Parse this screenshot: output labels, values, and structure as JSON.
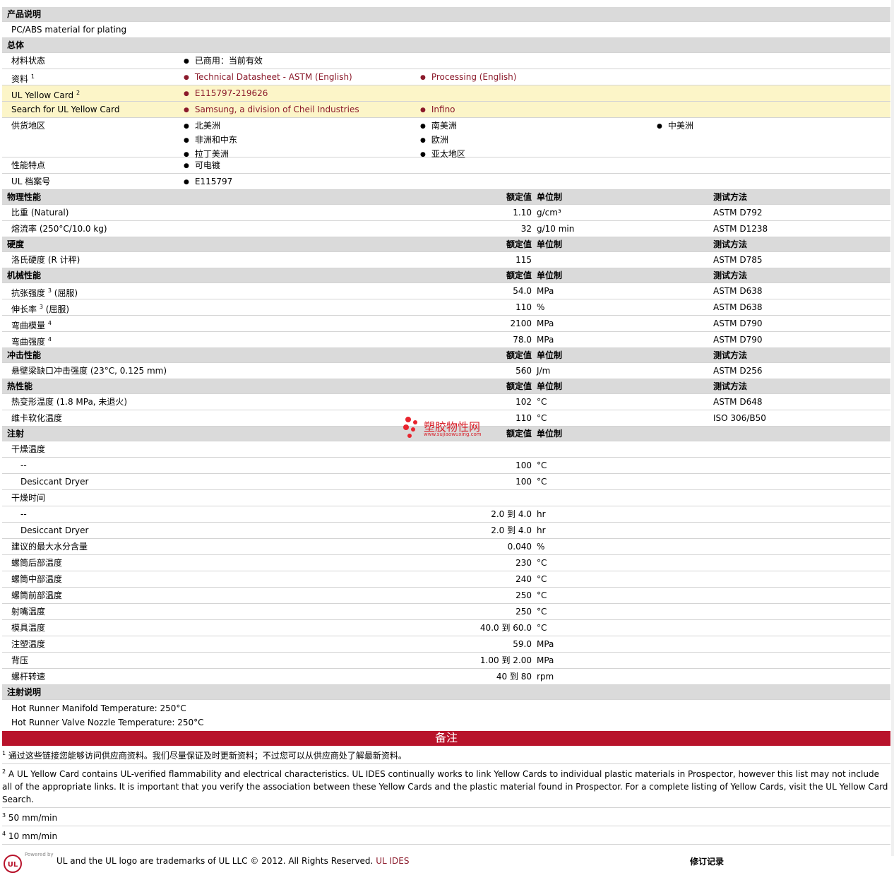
{
  "desc": {
    "header": "产品说明",
    "text": "PC/ABS material for plating"
  },
  "general": {
    "header": "总体",
    "status_label": "材料状态",
    "status_value": "已商用：当前有效",
    "docs_label": "资料",
    "docs_sup": "1",
    "docs": [
      "Technical Datasheet - ASTM (English)",
      "Processing (English)"
    ],
    "yc_label": "UL Yellow Card",
    "yc_sup": "2",
    "yc_value": "E115797-219626",
    "search_label": "Search for UL Yellow Card",
    "search": [
      "Samsung, a division of Cheil Industries",
      "Infino"
    ],
    "region_label": "供货地区",
    "regions": [
      "北美洲",
      "南美洲",
      "中美洲",
      "非洲和中东",
      "欧洲",
      "拉丁美洲",
      "亚太地区"
    ],
    "feature_label": "性能特点",
    "feature_value": "可电镀",
    "ul_label": "UL 档案号",
    "ul_value": "E115797"
  },
  "col": {
    "nominal": "额定值",
    "unit": "单位制",
    "method": "测试方法"
  },
  "physical": {
    "header": "物理性能",
    "rows": [
      {
        "label": "比重  (Natural)",
        "value": "1.10",
        "unit": "g/cm³",
        "method": "ASTM D792"
      },
      {
        "label": "熔流率  (250°C/10.0 kg)",
        "value": "32",
        "unit": "g/10 min",
        "method": "ASTM D1238"
      }
    ]
  },
  "hardness": {
    "header": "硬度",
    "rows": [
      {
        "label": "洛氏硬度  (R 计秤)",
        "value": "115",
        "unit": "",
        "method": "ASTM D785"
      }
    ]
  },
  "mechanical": {
    "header": "机械性能",
    "rows": [
      {
        "label": "抗张强度",
        "sup": "3",
        "suffix": " (屈服)",
        "value": "54.0",
        "unit": "MPa",
        "method": "ASTM D638"
      },
      {
        "label": "伸长率",
        "sup": "3",
        "suffix": " (屈服)",
        "value": "110",
        "unit": "%",
        "method": "ASTM D638"
      },
      {
        "label": "弯曲模量",
        "sup": "4",
        "suffix": "",
        "value": "2100",
        "unit": "MPa",
        "method": "ASTM D790"
      },
      {
        "label": "弯曲强度",
        "sup": "4",
        "suffix": "",
        "value": "78.0",
        "unit": "MPa",
        "method": "ASTM D790"
      }
    ]
  },
  "impact": {
    "header": "冲击性能",
    "rows": [
      {
        "label": "悬壁梁缺口冲击强度  (23°C, 0.125 mm)",
        "value": "560",
        "unit": "J/m",
        "method": "ASTM D256"
      }
    ]
  },
  "thermal": {
    "header": "热性能",
    "rows": [
      {
        "label": "热变形温度  (1.8 MPa, 未退火)",
        "value": "102",
        "unit": "°C",
        "method": "ASTM D648"
      },
      {
        "label": "维卡软化温度",
        "value": "110",
        "unit": "°C",
        "method": "ISO 306/B50"
      }
    ]
  },
  "injection": {
    "header": "注射",
    "rows": [
      {
        "label": "干燥温度",
        "value": "",
        "unit": "",
        "ind": false
      },
      {
        "label": "--",
        "value": "100",
        "unit": "°C",
        "ind": true
      },
      {
        "label": "Desiccant Dryer",
        "value": "100",
        "unit": "°C",
        "ind": true
      },
      {
        "label": "干燥时间",
        "value": "",
        "unit": "",
        "ind": false
      },
      {
        "label": "--",
        "value": "2.0 到  4.0",
        "unit": "hr",
        "ind": true
      },
      {
        "label": "Desiccant Dryer",
        "value": "2.0 到  4.0",
        "unit": "hr",
        "ind": true
      },
      {
        "label": "建议的最大水分含量",
        "value": "0.040",
        "unit": "%",
        "ind": false
      },
      {
        "label": "螺筒后部温度",
        "value": "230",
        "unit": "°C",
        "ind": false
      },
      {
        "label": "螺筒中部温度",
        "value": "240",
        "unit": "°C",
        "ind": false
      },
      {
        "label": "螺筒前部温度",
        "value": "250",
        "unit": "°C",
        "ind": false
      },
      {
        "label": "射嘴温度",
        "value": "250",
        "unit": "°C",
        "ind": false
      },
      {
        "label": "模具温度",
        "value": "40.0 到  60.0",
        "unit": "°C",
        "ind": false
      },
      {
        "label": "注塑温度",
        "value": "59.0",
        "unit": "MPa",
        "ind": false
      },
      {
        "label": "背压",
        "value": "1.00 到  2.00",
        "unit": "MPa",
        "ind": false
      },
      {
        "label": "螺杆转速",
        "value": "40 到  80",
        "unit": "rpm",
        "ind": false
      }
    ]
  },
  "inj_notes": {
    "header": "注射说明",
    "lines": [
      "Hot Runner Manifold Temperature: 250°C",
      "Hot Runner Valve Nozzle Temperature: 250°C"
    ]
  },
  "notes": {
    "header": "备注",
    "items": [
      {
        "n": "1",
        "text": "通过这些链接您能够访问供应商资料。我们尽量保证及时更新资料；不过您可以从供应商处了解最新资料。"
      },
      {
        "n": "2",
        "text": "A UL Yellow Card contains UL-verified flammability and electrical characteristics. UL IDES continually works to link Yellow Cards to individual plastic materials in Prospector, however this list may not include all of the appropriate links. It is important that you verify the association between these Yellow Cards and the plastic material found in Prospector. For a complete listing of Yellow Cards, visit the UL Yellow Card Search."
      },
      {
        "n": "3",
        "text": "50 mm/min"
      },
      {
        "n": "4",
        "text": "10 mm/min"
      }
    ]
  },
  "footer": {
    "powered": "Powered by",
    "text": "UL and the UL logo are trademarks of UL LLC © 2012. All Rights Reserved.",
    "link": "UL IDES",
    "revision": "修订记录"
  },
  "watermark": {
    "cn": "塑胶物性网",
    "url": "www.sujiaowuxing.com"
  }
}
